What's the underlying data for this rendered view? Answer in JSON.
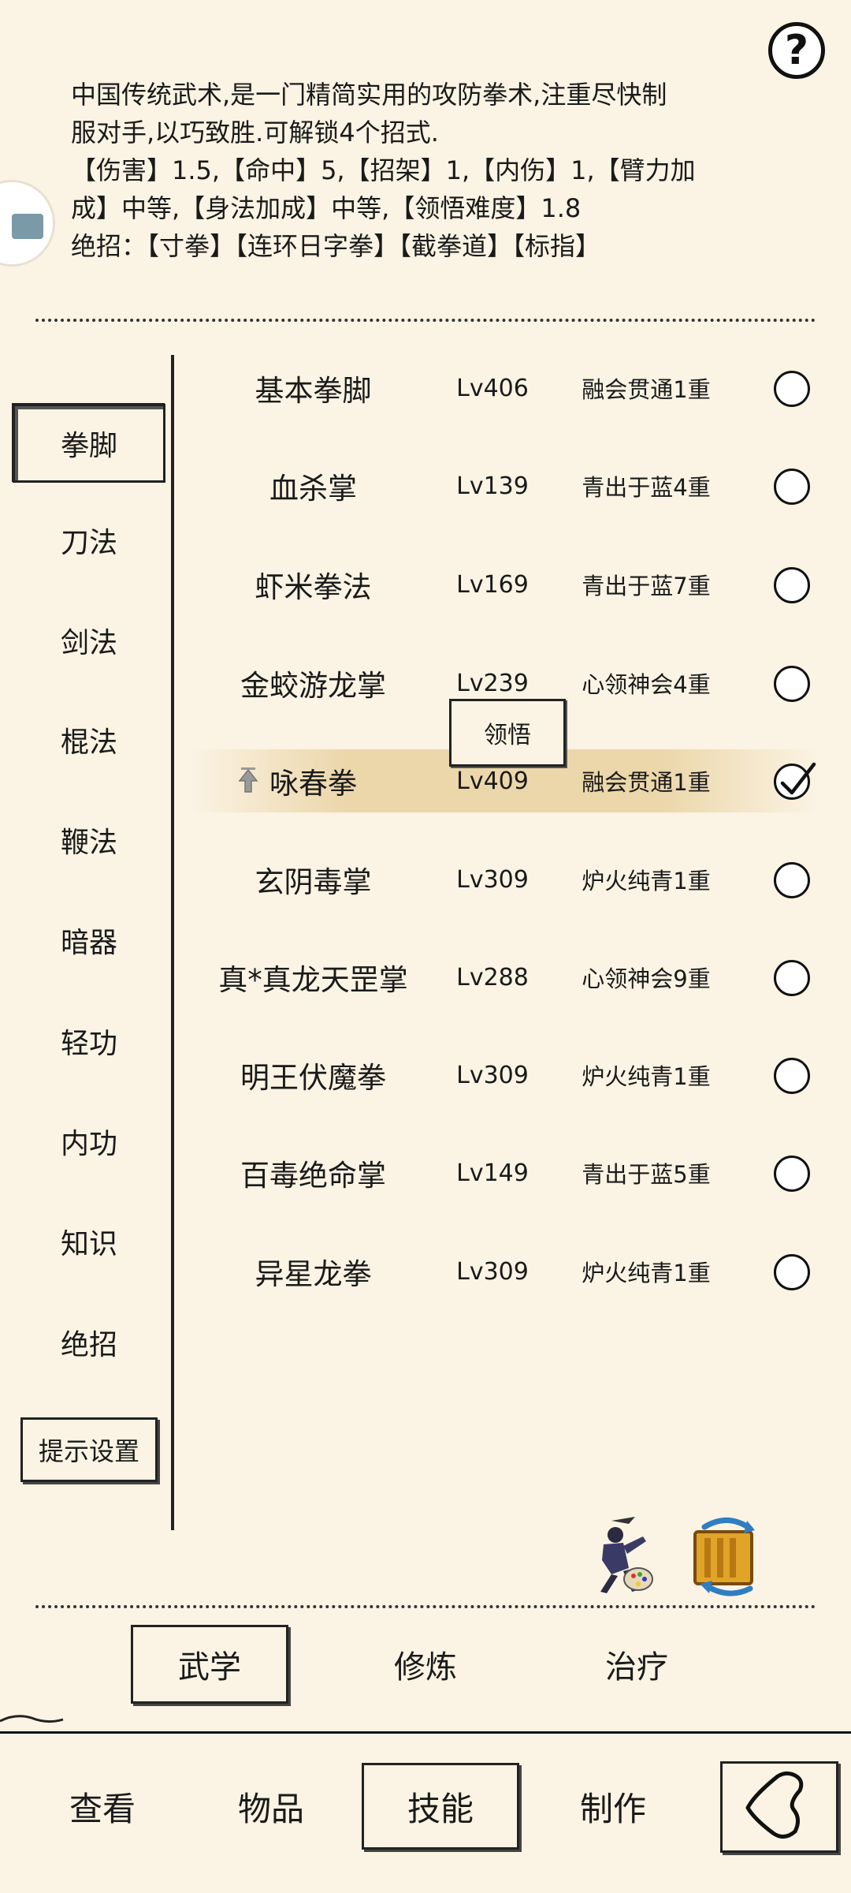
{
  "help": {
    "label": "?"
  },
  "description": {
    "line1": "中国传统武术,是一门精简实用的攻防拳术,注重尽快制",
    "line2": "服对手,以巧致胜.可解锁4个招式.",
    "line3": "【伤害】1.5,【命中】5,【招架】1,【内伤】1,【臂力加",
    "line4": "成】中等,【身法加成】中等,【领悟难度】1.8",
    "line5": "绝招：【寸拳】【连环日字拳】【截拳道】【标指】"
  },
  "categories": [
    {
      "label": "拳脚",
      "selected": true
    },
    {
      "label": "刀法"
    },
    {
      "label": "剑法"
    },
    {
      "label": "棍法"
    },
    {
      "label": "鞭法"
    },
    {
      "label": "暗器"
    },
    {
      "label": "轻功"
    },
    {
      "label": "内功"
    },
    {
      "label": "知识"
    },
    {
      "label": "绝招"
    }
  ],
  "hint_settings": "提示设置",
  "skills": [
    {
      "name": "基本拳脚",
      "level": "Lv406",
      "stage": "融会贯通1重",
      "checked": false
    },
    {
      "name": "血杀掌",
      "level": "Lv139",
      "stage": "青出于蓝4重",
      "checked": false
    },
    {
      "name": "虾米拳法",
      "level": "Lv169",
      "stage": "青出于蓝7重",
      "checked": false
    },
    {
      "name": "金蛟游龙掌",
      "level": "Lv239",
      "stage": "心领神会4重",
      "checked": false
    },
    {
      "name": "咏春拳",
      "level": "Lv409",
      "stage": "融会贯通1重",
      "checked": true
    },
    {
      "name": "玄阴毒掌",
      "level": "Lv309",
      "stage": "炉火纯青1重",
      "checked": false
    },
    {
      "name": "真*真龙天罡掌",
      "level": "Lv288",
      "stage": "心领神会9重",
      "checked": false
    },
    {
      "name": "明王伏魔拳",
      "level": "Lv309",
      "stage": "炉火纯青1重",
      "checked": false
    },
    {
      "name": "百毒绝命掌",
      "level": "Lv149",
      "stage": "青出于蓝5重",
      "checked": false
    },
    {
      "name": "异星龙拳",
      "level": "Lv309",
      "stage": "炉火纯青1重",
      "checked": false
    }
  ],
  "comprehend_button": "领悟",
  "tabs": [
    {
      "label": "武学",
      "selected": true
    },
    {
      "label": "修炼"
    },
    {
      "label": "治疗"
    }
  ],
  "bottom_nav": [
    {
      "label": "查看"
    },
    {
      "label": "物品"
    },
    {
      "label": "技能",
      "selected": true
    },
    {
      "label": "制作"
    }
  ],
  "icons": {
    "help": "question-icon",
    "back": "back-arrow-icon",
    "ninja": "ninja-palette-icon",
    "scroll": "scroll-swap-icon"
  }
}
